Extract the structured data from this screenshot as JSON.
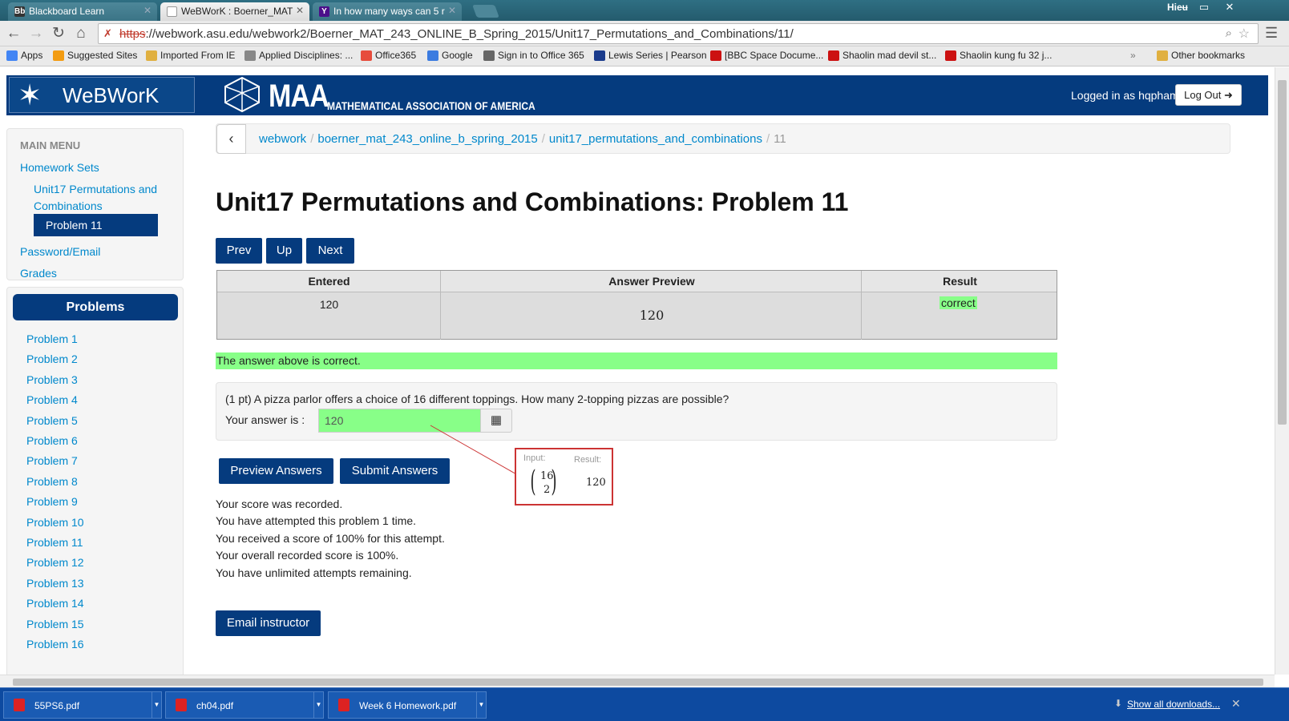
{
  "browser": {
    "tabs": [
      {
        "title": "Blackboard Learn",
        "icon_text": "Bb"
      },
      {
        "title": "WeBWorK : Boerner_MAT",
        "icon_text": ""
      },
      {
        "title": "In how many ways can 5 r",
        "icon_text": "Y"
      }
    ],
    "window_user": "Hieu",
    "window_controls": {
      "minimize": "–",
      "restore": "▭",
      "close": "✕"
    },
    "nav": {
      "back": "←",
      "forward": "→",
      "reload": "↻",
      "home": "⌂"
    },
    "url_scheme": "https",
    "url_rest": "://webwork.asu.edu/webwork2/Boerner_MAT_243_ONLINE_B_Spring_2015/Unit17_Permutations_and_Combinations/11/",
    "bookmarks": [
      {
        "label": "Apps",
        "color": "#4285f4"
      },
      {
        "label": "Suggested Sites",
        "color": "#f39c12"
      },
      {
        "label": "Imported From IE",
        "color": "#e0b040"
      },
      {
        "label": "Applied Disciplines: ...",
        "color": "#888888"
      },
      {
        "label": "Office365",
        "color": "#e74c3c"
      },
      {
        "label": "Google",
        "color": "#3b7be0"
      },
      {
        "label": "Sign in to Office 365",
        "color": "#666666"
      },
      {
        "label": "Lewis Series | Pearson",
        "color": "#1a3b8c"
      },
      {
        "label": "[BBC Space Docume...",
        "color": "#cc1111"
      },
      {
        "label": "Shaolin mad devil st...",
        "color": "#cc1111"
      },
      {
        "label": "Shaolin kung fu 32 j...",
        "color": "#cc1111"
      }
    ],
    "bookmarks_overflow": "»",
    "other_bookmarks": "Other bookmarks"
  },
  "header": {
    "brand": "WeBWorK",
    "maa_big": "MAA",
    "maa_small": "MATHEMATICAL ASSOCIATION OF AMERICA",
    "logged_in": "Logged in as hqpham.",
    "logout": "Log Out ➜"
  },
  "main_menu": {
    "heading": "MAIN MENU",
    "homework_sets": "Homework Sets",
    "set_line1": "Unit17 Permutations and",
    "set_line2": "Combinations",
    "active_problem": "Problem 11",
    "password": "Password/Email",
    "grades": "Grades"
  },
  "problems_panel": {
    "heading": "Problems",
    "items": [
      "Problem 1",
      "Problem 2",
      "Problem 3",
      "Problem 4",
      "Problem 5",
      "Problem 6",
      "Problem 7",
      "Problem 8",
      "Problem 9",
      "Problem 10",
      "Problem 11",
      "Problem 12",
      "Problem 13",
      "Problem 14",
      "Problem 15",
      "Problem 16"
    ]
  },
  "breadcrumb": {
    "back": "‹",
    "items": [
      "webwork",
      "boerner_mat_243_online_b_spring_2015",
      "unit17_permutations_and_combinations"
    ],
    "current": "11"
  },
  "title": "Unit17 Permutations and Combinations: Problem 11",
  "nav_buttons": {
    "prev": "Prev",
    "up": "Up",
    "next": "Next"
  },
  "results_table": {
    "headers": [
      "Entered",
      "Answer Preview",
      "Result"
    ],
    "entered": "120",
    "preview": "120",
    "result": "correct"
  },
  "correct_message": "The answer above is correct.",
  "problem": {
    "text": "(1 pt) A pizza parlor offers a choice of 16 different toppings. How many 2-topping pizzas are possible?",
    "answer_label": "Your answer is :",
    "answer_value": "120",
    "mq_button": "▦"
  },
  "popover": {
    "input_label": "Input:",
    "result_label": "Result:",
    "binom_n": "16",
    "binom_k": "2",
    "result_value": "120"
  },
  "actions": {
    "preview": "Preview Answers",
    "submit": "Submit Answers"
  },
  "score_lines": [
    "Your score was recorded.",
    "You have attempted this problem 1 time.",
    "You received a score of 100% for this attempt.",
    "Your overall recorded score is 100%.",
    "You have unlimited attempts remaining."
  ],
  "email_instructor": "Email instructor",
  "downloads": {
    "items": [
      "55PS6.pdf",
      "ch04.pdf",
      "Week 6 Homework.pdf"
    ],
    "show_all": "Show all downloads...",
    "close": "✕"
  },
  "colors": {
    "brand_blue": "#053b7e",
    "correct_green": "#88ff88",
    "link": "#0088cc"
  }
}
